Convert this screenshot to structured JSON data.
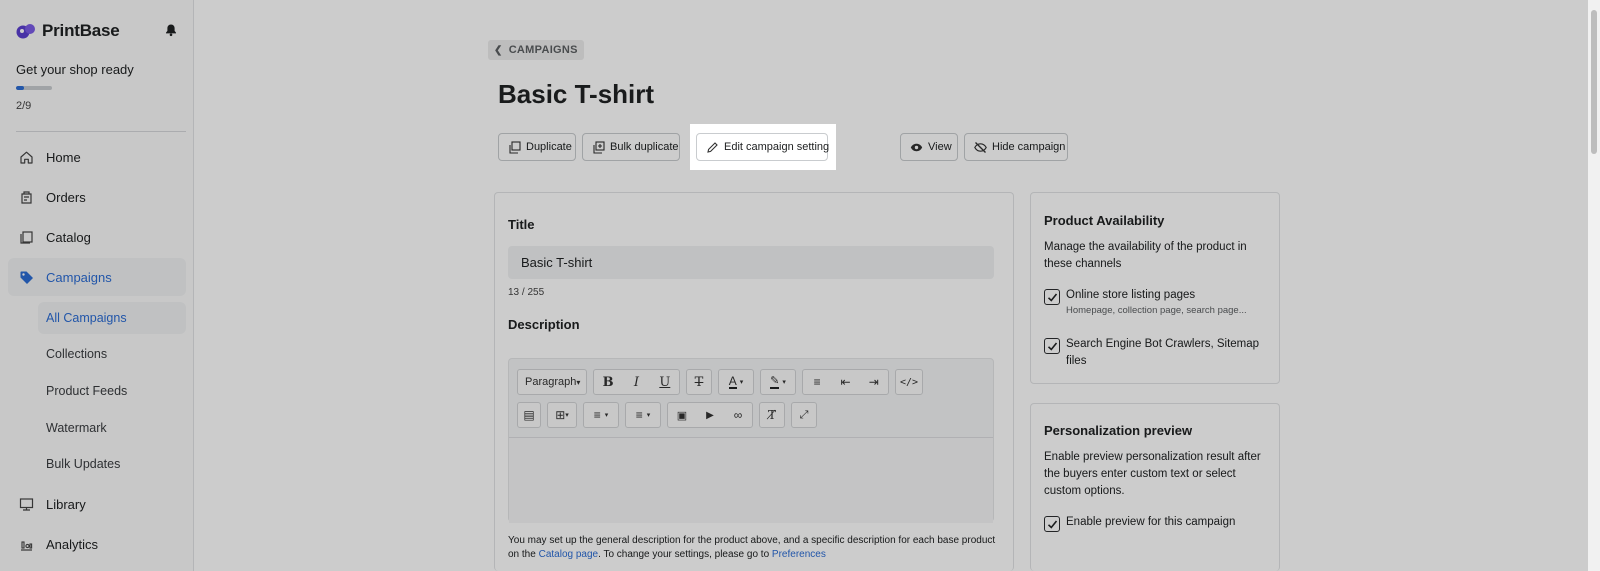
{
  "sidebar": {
    "brand": "PrintBase",
    "setup_title": "Get your shop ready",
    "progress_count": "2/9",
    "progress_fraction": 0.22,
    "nav": [
      {
        "label": "Home",
        "icon": "home-icon"
      },
      {
        "label": "Orders",
        "icon": "orders-icon"
      },
      {
        "label": "Catalog",
        "icon": "catalog-icon"
      },
      {
        "label": "Campaigns",
        "icon": "tag-icon"
      }
    ],
    "sub_items": [
      "All Campaigns",
      "Collections",
      "Product Feeds",
      "Watermark",
      "Bulk Updates"
    ],
    "nav_bottom": [
      {
        "label": "Library",
        "icon": "library-icon"
      },
      {
        "label": "Analytics",
        "icon": "analytics-icon"
      }
    ]
  },
  "header": {
    "breadcrumb": "CAMPAIGNS",
    "title": "Basic T-shirt"
  },
  "actions": {
    "duplicate": "Duplicate",
    "bulk_duplicate": "Bulk duplicate",
    "edit_setting": "Edit campaign setting",
    "view": "View",
    "hide": "Hide campaign"
  },
  "main_card": {
    "title_label": "Title",
    "title_value": "Basic T-shirt",
    "counter": "13 / 255",
    "description_label": "Description",
    "paragraph_select": "Paragraph",
    "help_text_1": "You may set up the general description for the product above, and a specific description for each base product on the ",
    "help_link_1": "Catalog page",
    "help_text_2": ". To change your settings, please go to ",
    "help_link_2": "Preferences"
  },
  "availability": {
    "title": "Product Availability",
    "description": "Manage the availability of the product in these channels",
    "option1_label": "Online store listing pages",
    "option1_sub": "Homepage, collection page, search page...",
    "option2_label": "Search Engine Bot Crawlers, Sitemap files"
  },
  "personalization": {
    "title": "Personalization preview",
    "description": "Enable preview personalization result after the buyers enter custom text or select custom options.",
    "option_label": "Enable preview for this campaign"
  },
  "colors": {
    "accent": "#2b6cd4",
    "brand": "#5b3fd0"
  }
}
